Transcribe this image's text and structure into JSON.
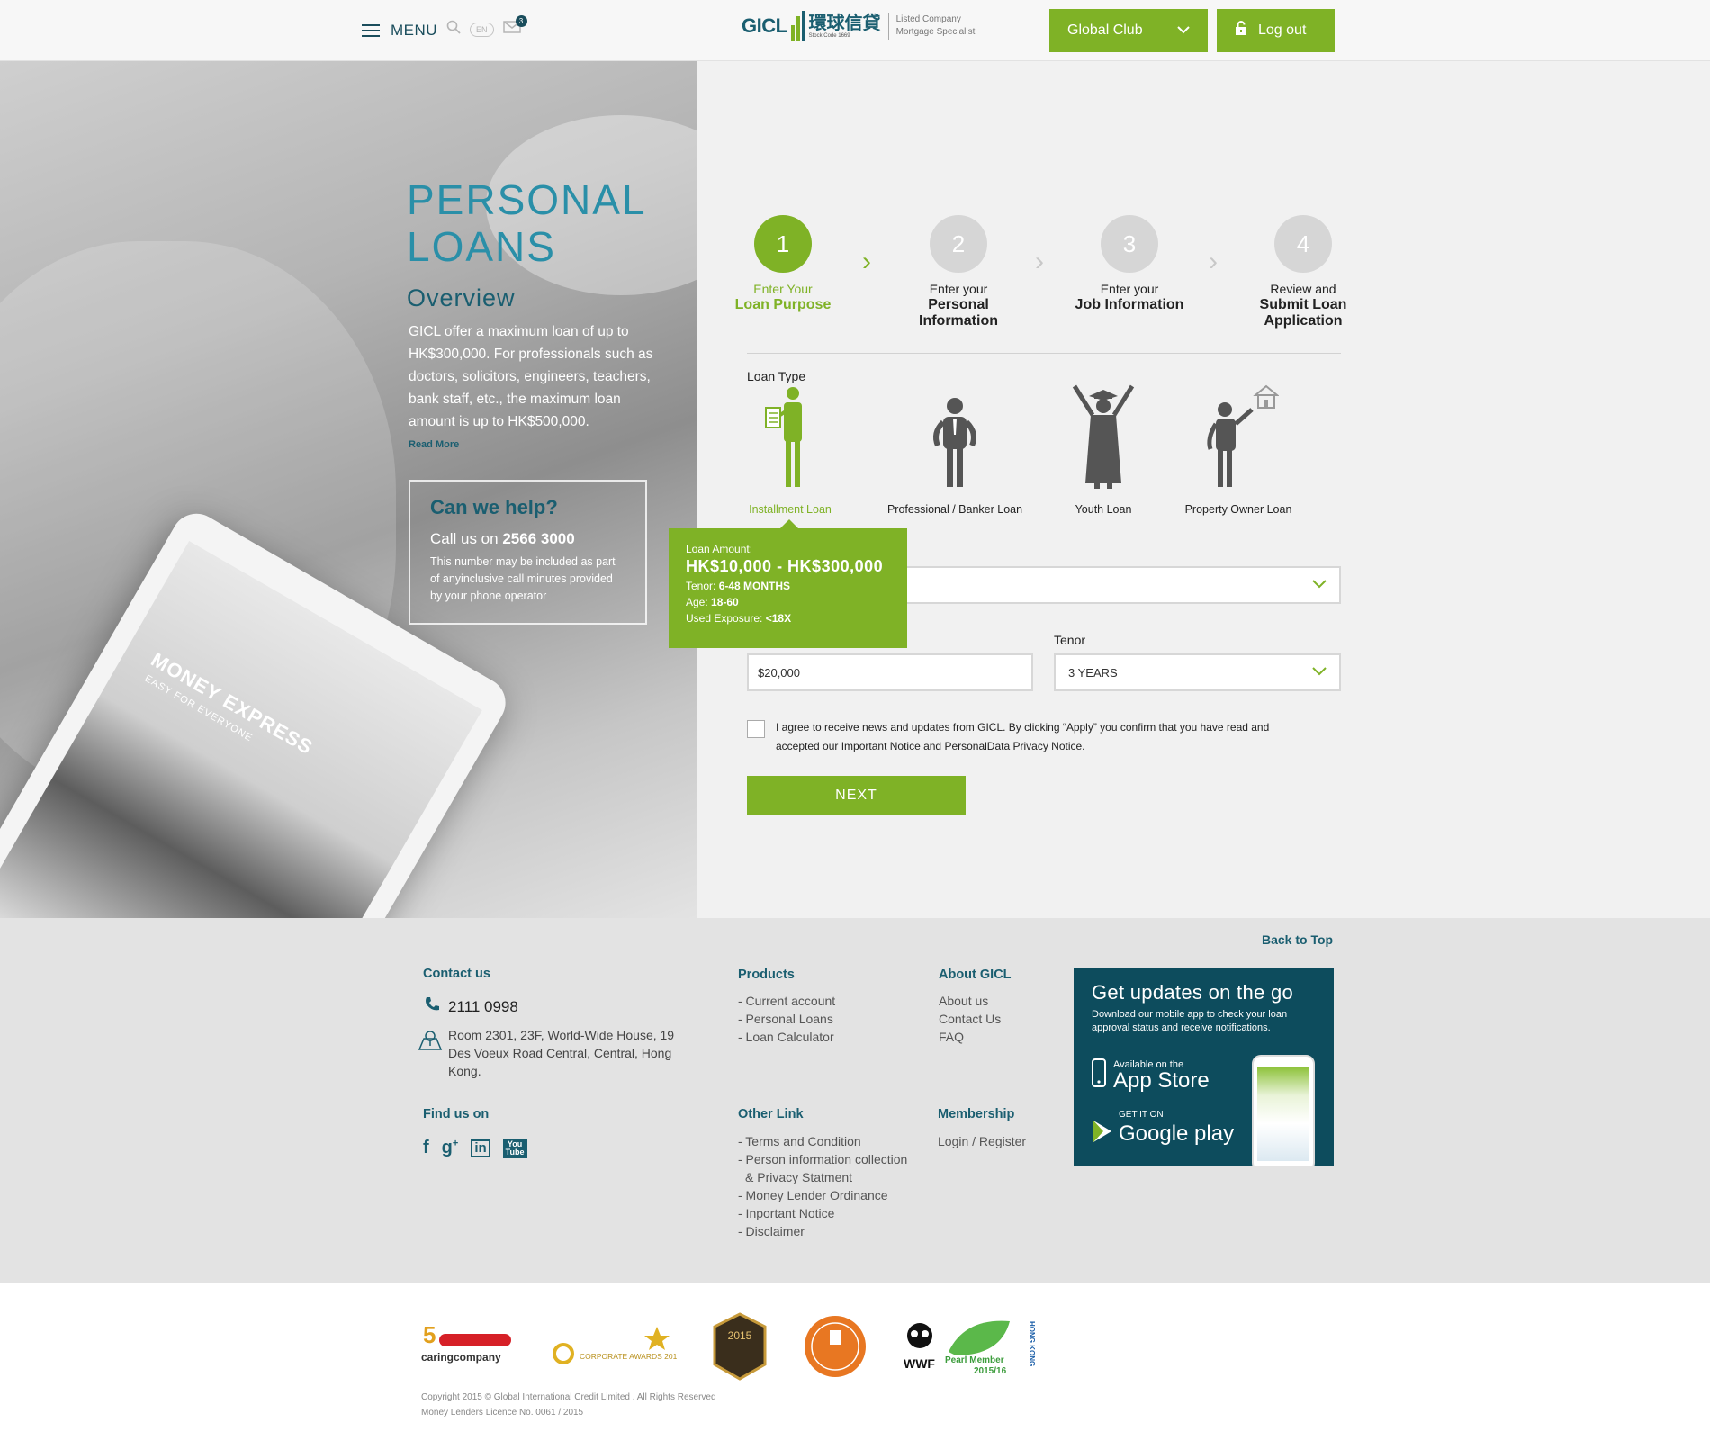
{
  "header": {
    "menu_label": "MENU",
    "lang": "EN",
    "mail_count": "3",
    "logo_en": "GICL",
    "logo_cn": "環球信貸",
    "logo_stock": "Stock Code 1669",
    "logo_tag_1": "Listed Company",
    "logo_tag_2": "Mortgage Specialist",
    "club_label": "Global Club",
    "logout_label": "Log out"
  },
  "hero": {
    "title_1": "PERSONAL",
    "title_2": "LOANS",
    "overview": "Overview",
    "description": "GICL offer a maximum loan of up to HK$300,000. For professionals such as doctors, solicitors, engineers, teachers, bank staff, etc., the maximum loan amount is up to HK$500,000.",
    "read_more": "Read More",
    "tablet_text": "MONEY EXPRESS",
    "tablet_sub": "EASY FOR EVERYONE",
    "help": {
      "title": "Can we help?",
      "call_prefix": "Call us on",
      "phone": "2566 3000",
      "note": "This number may be included as part of anyinclusive call minutes provided by your phone operator"
    }
  },
  "steps": [
    {
      "number": "1",
      "line1": "Enter Your",
      "line2": "Loan Purpose"
    },
    {
      "number": "2",
      "line1": "Enter your",
      "line2": "Personal Information"
    },
    {
      "number": "3",
      "line1": "Enter your",
      "line2": "Job Information"
    },
    {
      "number": "4",
      "line1": "Review and",
      "line2": "Submit Loan Application"
    }
  ],
  "form": {
    "loan_type_label": "Loan Type",
    "loan_types": [
      {
        "label": "Installment Loan",
        "icon": "installment-loan-icon"
      },
      {
        "label": "Professional / Banker Loan",
        "icon": "professional-loan-icon"
      },
      {
        "label": "Youth Loan",
        "icon": "youth-loan-icon"
      },
      {
        "label": "Property Owner Loan",
        "icon": "property-owner-loan-icon"
      }
    ],
    "tooltip": {
      "amount_label": "Loan Amount:",
      "amount": "HK$10,000 - HK$300,000",
      "tenor_label": "Tenor:",
      "tenor": "6-48 MONTHS",
      "age_label": "Age:",
      "age": "18-60",
      "exposure_label": "Used Exposure:",
      "exposure": "<18X"
    },
    "purpose_value": "",
    "amount_value": "$20,000",
    "tenor_label": "Tenor",
    "tenor_value": "3 YEARS",
    "agree_text": "I agree to receive news and updates from GICL. By clicking “Apply” you confirm that you have read and accepted our Important Notice and PersonalData Privacy Notice.",
    "next_label": "NEXT"
  },
  "footer": {
    "back_to_top": "Back to Top",
    "contact_heading": "Contact us",
    "phone": "2111 0998",
    "address": "Room 2301, 23F, World-Wide House, 19 Des Voeux Road Central, Central, Hong Kong.",
    "find_us": "Find us on",
    "products_heading": "Products",
    "products": [
      "- Current account",
      "- Personal Loans",
      "- Loan Calculator"
    ],
    "about_heading": "About GICL",
    "about": [
      "About us",
      "Contact Us",
      "FAQ"
    ],
    "other_heading": "Other Link",
    "other_links": [
      "- Terms and Condition",
      "- Person information collection",
      "  & Privacy Statment",
      "- Money Lender Ordinance",
      "- Inportant Notice",
      "- Disclaimer"
    ],
    "membership_heading": "Membership",
    "membership": "Login / Register",
    "app": {
      "title": "Get updates on the go",
      "sub": "Download our mobile app to check your loan approval status and receive notifications.",
      "appstore_small": "Available on the",
      "appstore_big": "App Store",
      "gplay_small": "GET IT ON",
      "gplay_big": "Google play"
    },
    "copyright_1": "Copyright 2015 © Global International Credit Limited . All Rights Reserved",
    "copyright_2": "Money Lenders Licence No. 0061 / 2015",
    "awards": {
      "caring": "caringcompany",
      "corporate": "CORPORATE AWARDS 2015",
      "year": "2015",
      "wwf": "WWF",
      "pearl": "Pearl Member",
      "pearl_year": "2015/16",
      "hk": "HONG KONG"
    }
  },
  "colors": {
    "accent": "#7fb226",
    "brand_dark": "#1a5e70",
    "brand_light": "#2a8fa8",
    "app_box": "#0d4c5d"
  }
}
